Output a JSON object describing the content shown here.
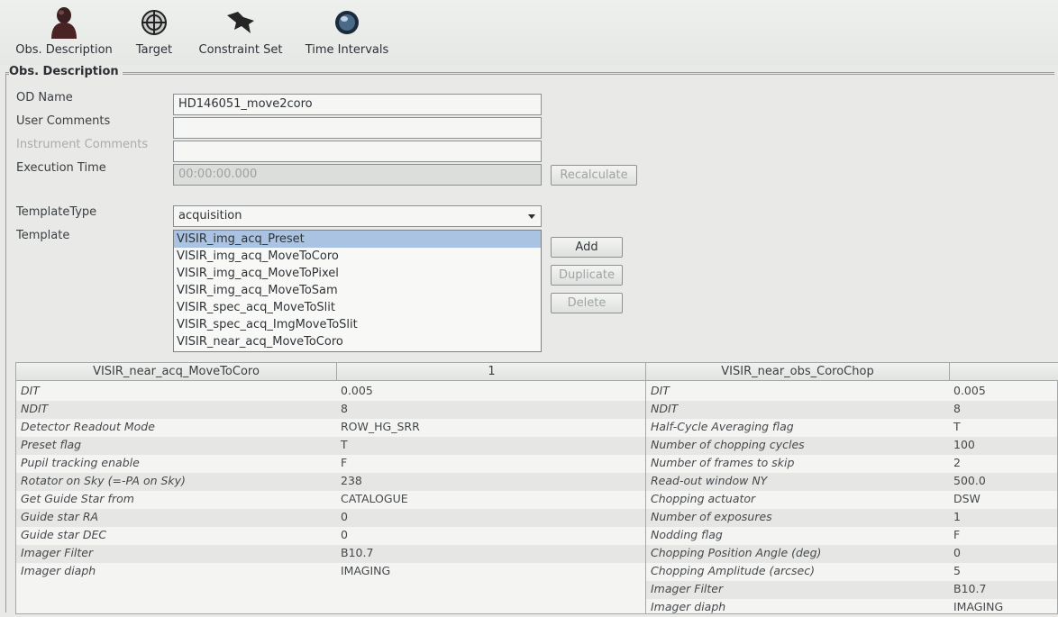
{
  "toolbar": {
    "items": [
      {
        "label": "Obs. Description",
        "icon": "person-silhouette-icon"
      },
      {
        "label": "Target",
        "icon": "target-globe-icon"
      },
      {
        "label": "Constraint Set",
        "icon": "bird-constraint-icon"
      },
      {
        "label": "Time Intervals",
        "icon": "clock-icon"
      }
    ]
  },
  "section": {
    "title": "Obs. Description"
  },
  "form": {
    "od_name_label": "OD Name",
    "od_name_value": "HD146051_move2coro",
    "user_comments_label": "User Comments",
    "user_comments_value": "",
    "instrument_comments_label": "Instrument Comments",
    "instrument_comments_value": "",
    "execution_time_label": "Execution Time",
    "execution_time_value": "00:00:00.000",
    "recalculate_label": "Recalculate",
    "template_type_label": "TemplateType",
    "template_type_value": "acquisition",
    "template_label": "Template",
    "templates": [
      "VISIR_img_acq_Preset",
      "VISIR_img_acq_MoveToCoro",
      "VISIR_img_acq_MoveToPixel",
      "VISIR_img_acq_MoveToSam",
      "VISIR_spec_acq_MoveToSlit",
      "VISIR_spec_acq_ImgMoveToSlit",
      "VISIR_near_acq_MoveToCoro"
    ],
    "selected_template_index": 0,
    "add_label": "Add",
    "duplicate_label": "Duplicate",
    "delete_label": "Delete"
  },
  "left_table": {
    "header_name": "VISIR_near_acq_MoveToCoro",
    "header_value": "1",
    "rows": [
      {
        "param": "DIT",
        "value": "0.005"
      },
      {
        "param": "NDIT",
        "value": "8"
      },
      {
        "param": "Detector Readout Mode",
        "value": "ROW_HG_SRR"
      },
      {
        "param": "Preset flag",
        "value": "T"
      },
      {
        "param": "Pupil tracking enable",
        "value": "F"
      },
      {
        "param": "Rotator on Sky (=-PA on Sky)",
        "value": "238"
      },
      {
        "param": "Get Guide Star from",
        "value": "CATALOGUE"
      },
      {
        "param": "Guide star RA",
        "value": "0"
      },
      {
        "param": "Guide star DEC",
        "value": "0"
      },
      {
        "param": "Imager Filter",
        "value": "B10.7"
      },
      {
        "param": "Imager diaph",
        "value": "IMAGING"
      }
    ]
  },
  "right_table": {
    "header_name": "VISIR_near_obs_CoroChop",
    "header_value": "",
    "rows": [
      {
        "param": "DIT",
        "value": "0.005"
      },
      {
        "param": "NDIT",
        "value": "8"
      },
      {
        "param": "Half-Cycle Averaging flag",
        "value": "T"
      },
      {
        "param": "Number of chopping cycles",
        "value": "100"
      },
      {
        "param": "Number of frames to skip",
        "value": "2"
      },
      {
        "param": "Read-out window NY",
        "value": "500.0"
      },
      {
        "param": "Chopping actuator",
        "value": "DSW"
      },
      {
        "param": "Number of exposures",
        "value": "1"
      },
      {
        "param": "Nodding flag",
        "value": "F"
      },
      {
        "param": "Chopping Position Angle (deg)",
        "value": "0"
      },
      {
        "param": "Chopping Amplitude (arcsec)",
        "value": "5"
      },
      {
        "param": "Imager Filter",
        "value": "B10.7"
      },
      {
        "param": "Imager diaph",
        "value": "IMAGING"
      }
    ]
  }
}
